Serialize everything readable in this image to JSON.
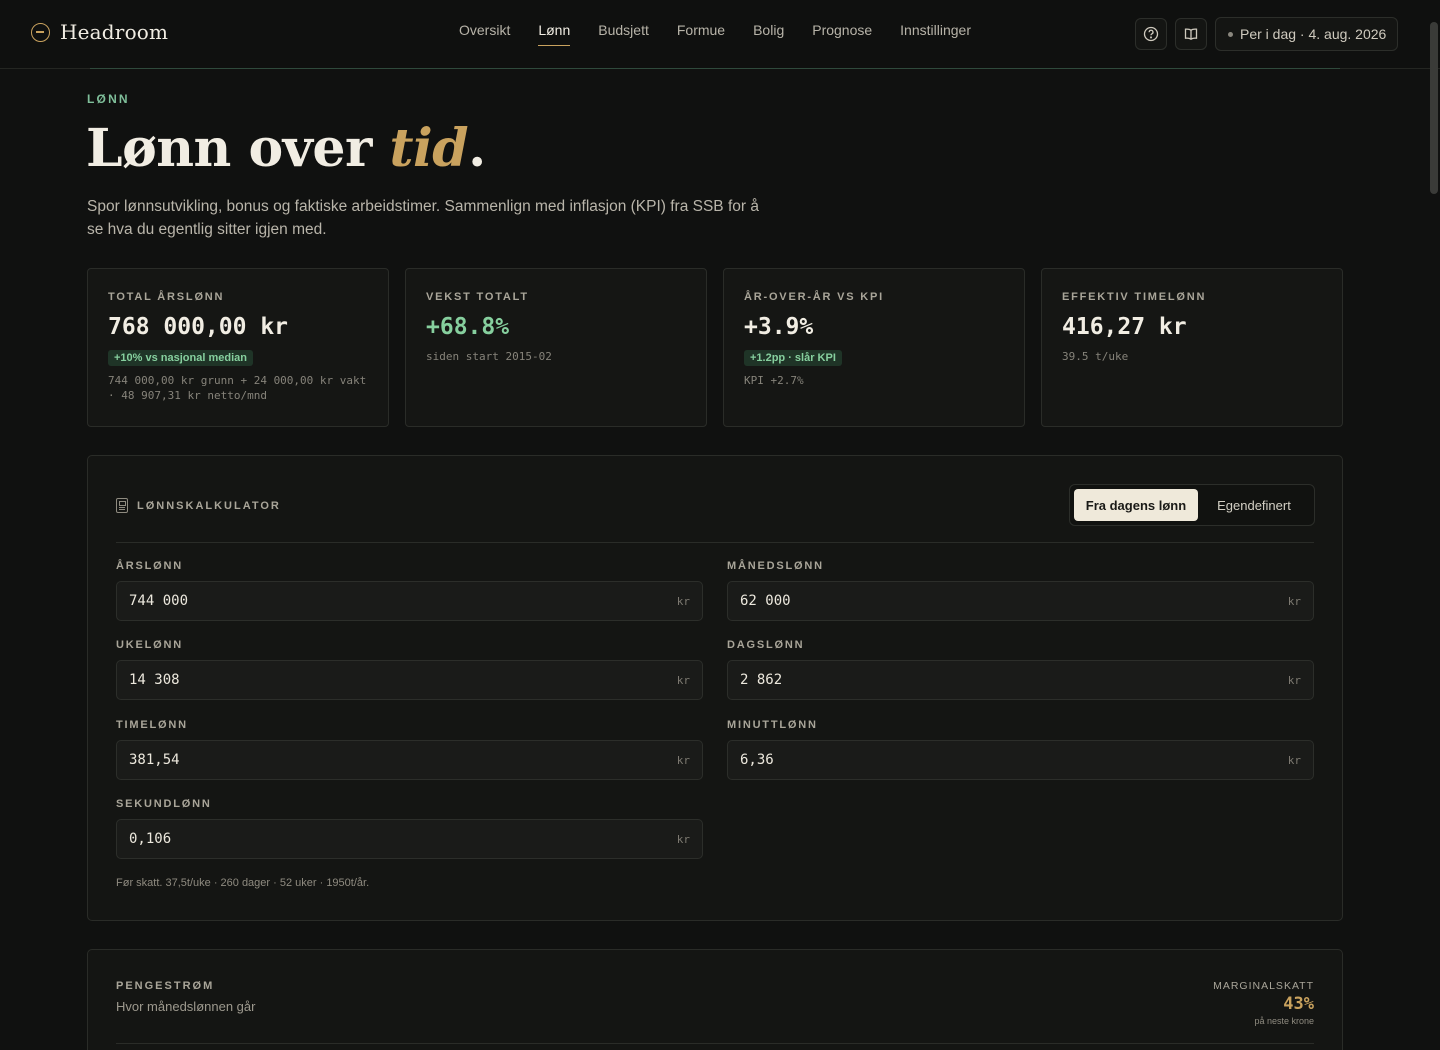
{
  "brand": {
    "name": "Headroom"
  },
  "nav": [
    {
      "label": "Oversikt",
      "active": false
    },
    {
      "label": "Lønn",
      "active": true
    },
    {
      "label": "Budsjett",
      "active": false
    },
    {
      "label": "Formue",
      "active": false
    },
    {
      "label": "Bolig",
      "active": false
    },
    {
      "label": "Prognose",
      "active": false
    },
    {
      "label": "Innstillinger",
      "active": false
    }
  ],
  "header": {
    "date_label": "Per i dag · 4. aug. 2026",
    "help_icon": "help-circle-icon",
    "guide_icon": "book-open-icon"
  },
  "hero": {
    "eyebrow": "LØNN",
    "title_main": "Lønn over ",
    "title_accent": "tid",
    "title_end": ".",
    "subtitle": "Spor lønnsutvikling, bonus og faktiske arbeidstimer. Sammenlign med inflasjon (KPI) fra SSB for å se hva du egentlig sitter igjen med."
  },
  "kpis": [
    {
      "label": "TOTAL ÅRSLØNN",
      "value": "768 000,00 kr",
      "badge": "+10% vs nasjonal median",
      "note": "744 000,00 kr grunn + 24 000,00 kr vakt · 48 907,31 kr netto/mnd"
    },
    {
      "label": "VEKST TOTALT",
      "value": "+68.8%",
      "badge": "",
      "note": "siden start 2015-02"
    },
    {
      "label": "ÅR-OVER-ÅR VS KPI",
      "value": "+3.9%",
      "badge": "+1.2pp · slår KPI",
      "note": "KPI +2.7%"
    },
    {
      "label": "EFFEKTIV TIMELØNN",
      "value": "416,27 kr",
      "badge": "",
      "note": "39.5 t/uke"
    }
  ],
  "calculator": {
    "title": "LØNNSKALKULATOR",
    "icon": "calculator-icon",
    "toggle": {
      "selected": "Fra dagens lønn",
      "other": "Egendefinert"
    },
    "fields": [
      {
        "label": "ÅRSLØNN",
        "value": "744 000",
        "unit": "kr"
      },
      {
        "label": "MÅNEDSLØNN",
        "value": "62 000",
        "unit": "kr"
      },
      {
        "label": "UKELØNN",
        "value": "14 308",
        "unit": "kr"
      },
      {
        "label": "DAGSLØNN",
        "value": "2 862",
        "unit": "kr"
      },
      {
        "label": "TIMELØNN",
        "value": "381,54",
        "unit": "kr"
      },
      {
        "label": "MINUTTLØNN",
        "value": "6,36",
        "unit": "kr"
      },
      {
        "label": "SEKUNDLØNN",
        "value": "0,106",
        "unit": "kr"
      }
    ],
    "footnote": "Før skatt. 37,5t/uke · 260 dager · 52 uker · 1950t/år."
  },
  "cashflow": {
    "title": "PENGESTRØM",
    "subtitle": "Hvor månedslønnen går",
    "marginal_label": "MARGINALSKATT",
    "marginal_value": "43%",
    "marginal_note": "på neste krone"
  },
  "colors": {
    "accent_gold": "#c9a25e",
    "positive_green": "#86cf9e",
    "background": "#101110"
  }
}
